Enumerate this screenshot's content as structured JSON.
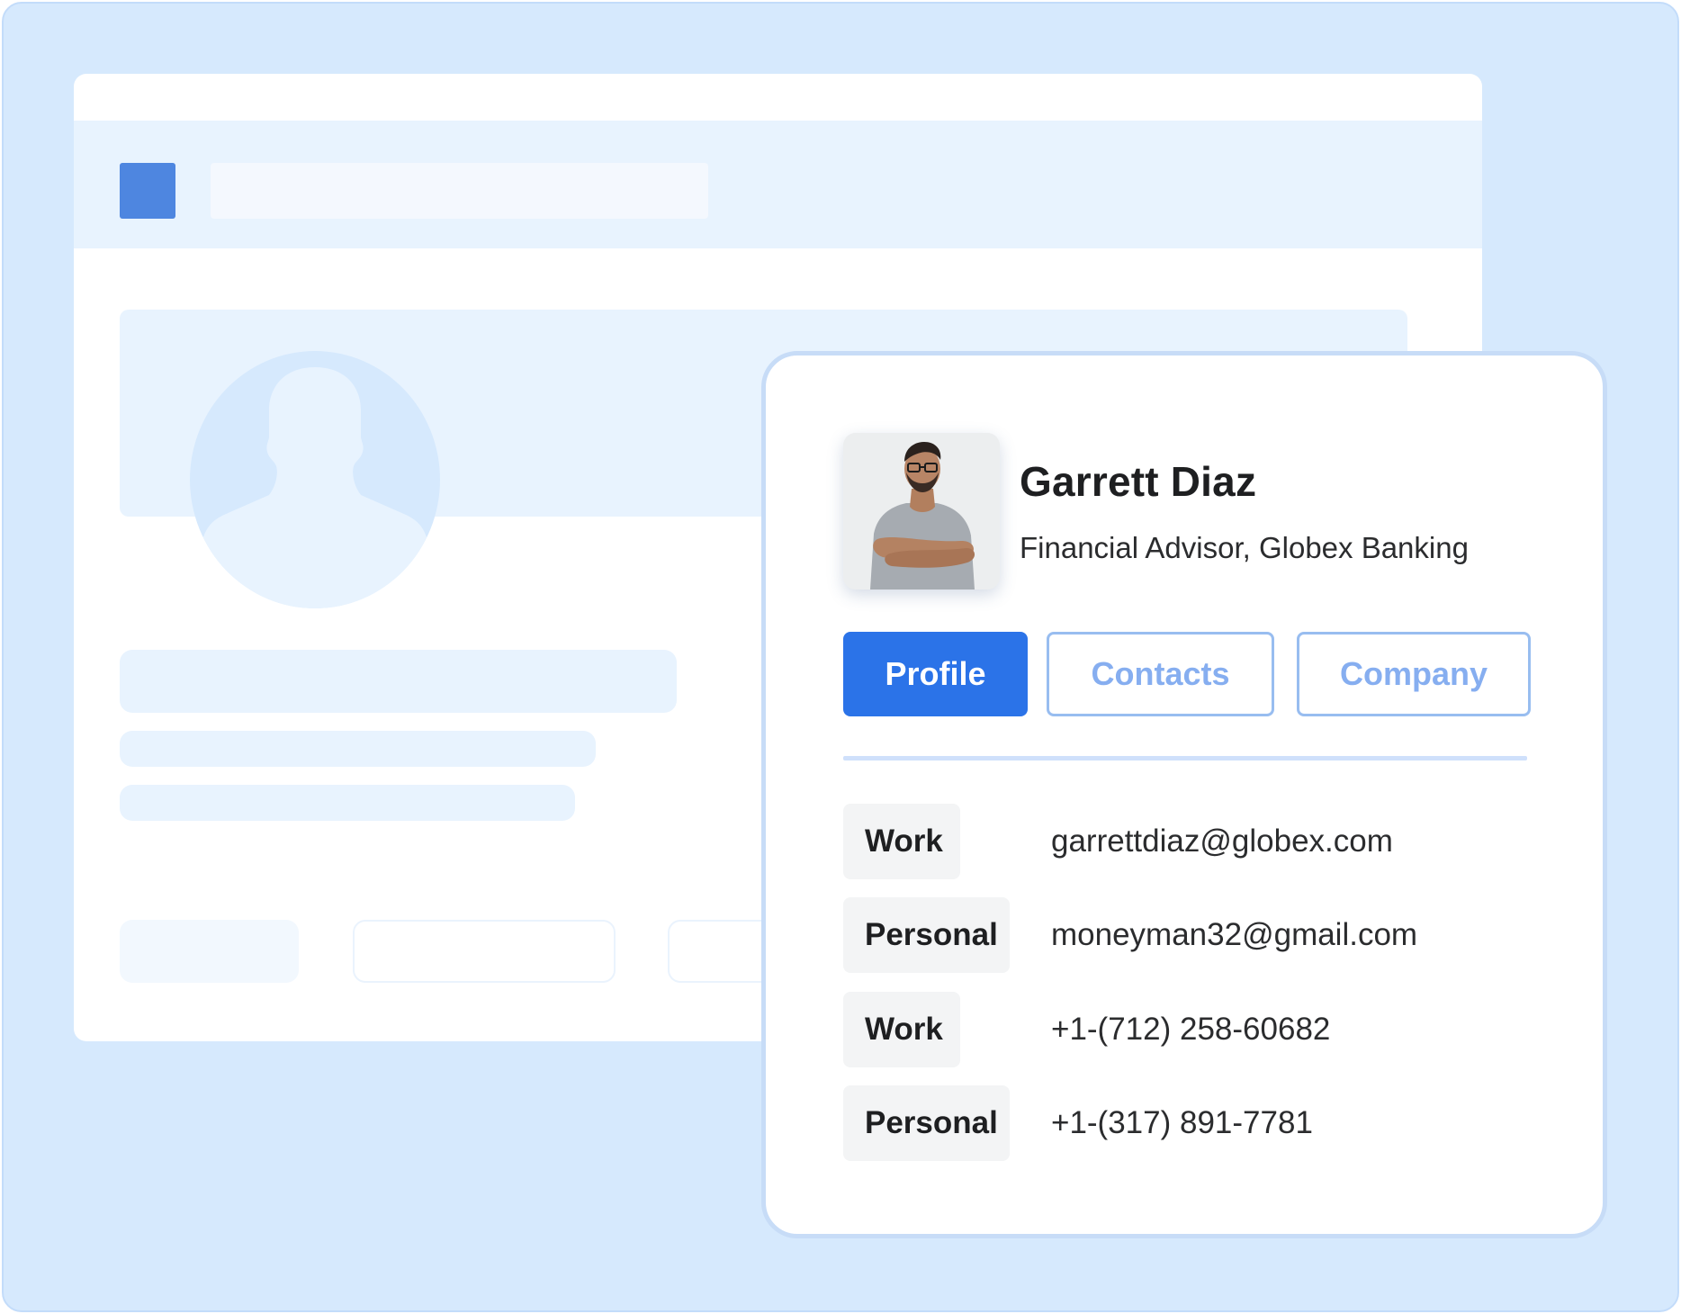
{
  "profile": {
    "name": "Garrett Diaz",
    "title": "Financial Advisor, Globex Banking"
  },
  "tabs": [
    {
      "label": "Profile",
      "active": true
    },
    {
      "label": "Contacts",
      "active": false
    },
    {
      "label": "Company",
      "active": false
    }
  ],
  "contacts": [
    {
      "type": "Work",
      "value": "garrettdiaz@globex.com"
    },
    {
      "type": "Personal",
      "value": "moneyman32@gmail.com"
    },
    {
      "type": "Work",
      "value": "+1-(712) 258-60682"
    },
    {
      "type": "Personal",
      "value": "+1-(317) 891-7781"
    }
  ],
  "colors": {
    "background": "#d6e9fd",
    "accent": "#2b73e8",
    "tab_outline": "#98bdf0",
    "placeholder": "#e8f3fe"
  }
}
